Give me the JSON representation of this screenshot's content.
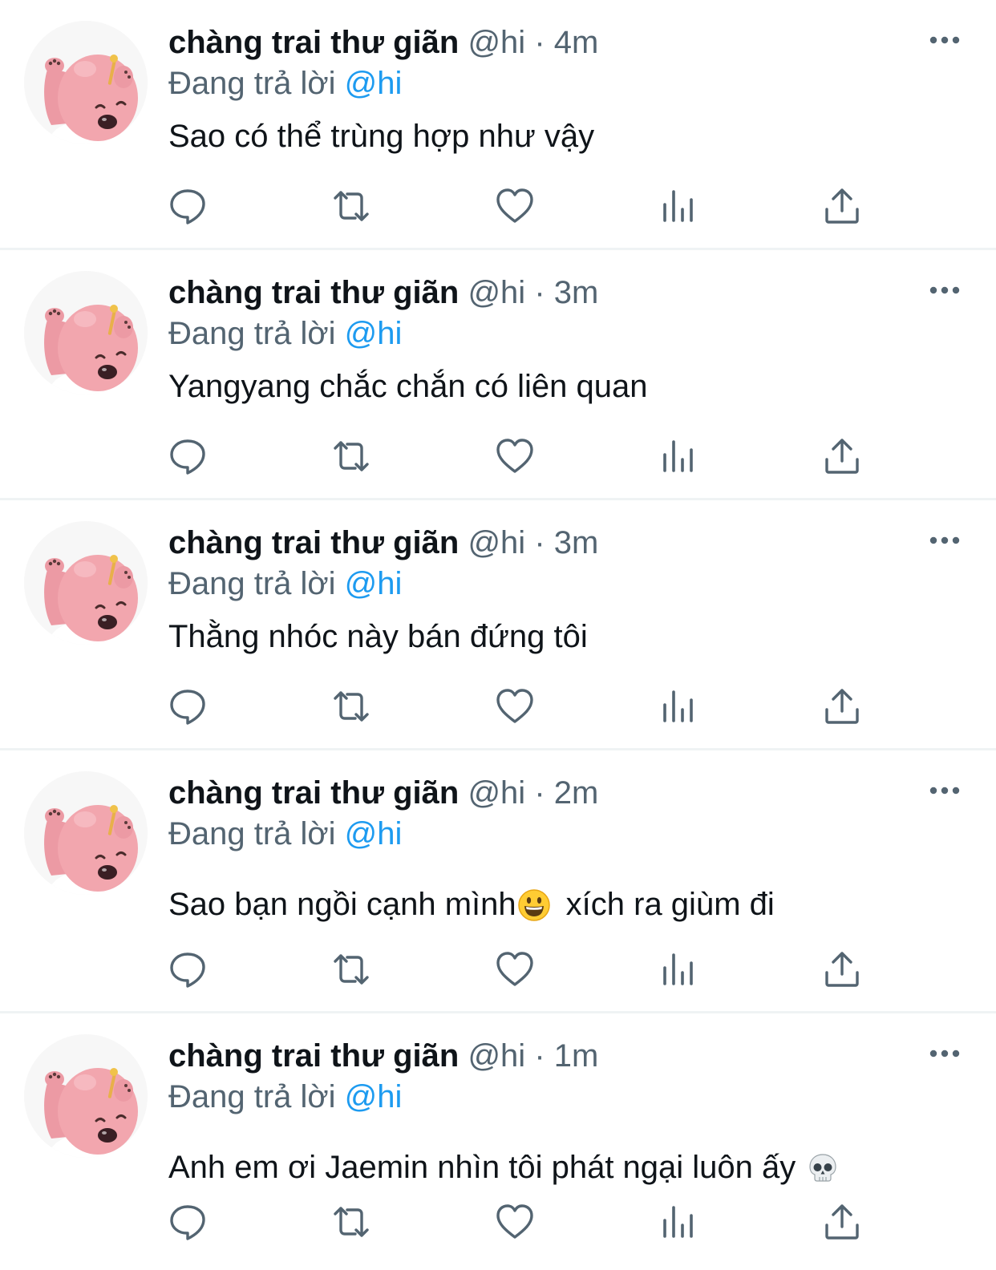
{
  "colors": {
    "text_primary": "#0f1419",
    "text_secondary": "#536471",
    "mention_blue": "#1d9bf0",
    "divider": "#eff3f4",
    "avatar_pink": "#f2a6ae"
  },
  "icons": {
    "reply": "speech-bubble-icon",
    "retweet": "retweet-icon",
    "like": "heart-icon",
    "views": "bar-chart-icon",
    "share": "share-upload-icon",
    "more": "more-dots-icon"
  },
  "tweets": [
    {
      "display_name": "chàng trai thư giãn",
      "handle": "@hi",
      "separator": "·",
      "time": "4m",
      "reply_prefix": "Đang trả lời",
      "reply_to": "@hi",
      "text": "Sao có thể trùng hợp như vậy"
    },
    {
      "display_name": "chàng trai thư giãn",
      "handle": "@hi",
      "separator": "·",
      "time": "3m",
      "reply_prefix": "Đang trả lời",
      "reply_to": "@hi",
      "text": "Yangyang chắc chắn có liên quan"
    },
    {
      "display_name": "chàng trai thư giãn",
      "handle": "@hi",
      "separator": "·",
      "time": "3m",
      "reply_prefix": "Đang trả lời",
      "reply_to": "@hi",
      "text": "Thằng nhóc này bán đứng tôi"
    },
    {
      "display_name": "chàng trai thư giãn",
      "handle": "@hi",
      "separator": "·",
      "time": "2m",
      "reply_prefix": "Đang trả lời",
      "reply_to": "@hi",
      "text_part1": "Sao bạn ngồi cạnh mình",
      "text_part2": "xích ra giùm đi",
      "emoji": "grinning-face-emoji"
    },
    {
      "display_name": "chàng trai thư giãn",
      "handle": "@hi",
      "separator": "·",
      "time": "1m",
      "reply_prefix": "Đang trả lời",
      "reply_to": "@hi",
      "text": "Anh em ơi Jaemin nhìn tôi phát ngại luôn ấy",
      "emoji": "skull-emoji"
    }
  ]
}
